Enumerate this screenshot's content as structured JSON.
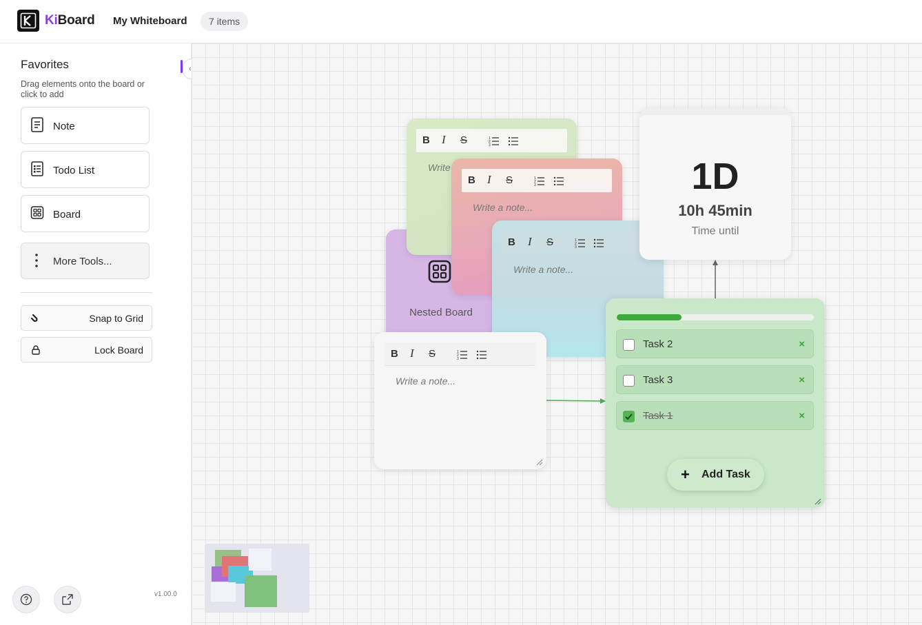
{
  "header": {
    "logo_prefix": "Ki",
    "logo_suffix": "Board",
    "board_title": "My Whiteboard",
    "items_count": "7 items"
  },
  "sidebar": {
    "title": "Favorites",
    "subtitle": "Drag elements onto the board or click to add",
    "tools": [
      {
        "label": "Note",
        "icon": "note-icon"
      },
      {
        "label": "Todo List",
        "icon": "todo-list-icon"
      },
      {
        "label": "Board",
        "icon": "board-icon"
      }
    ],
    "more_tools": "More Tools...",
    "snap_to_grid": "Snap to Grid",
    "lock_board": "Lock Board",
    "collapse_glyph": "‹",
    "version": "v1.00.0"
  },
  "canvas": {
    "note_placeholder": "Write a note...",
    "note_placeholder_truncated": "Write",
    "nested_board_label": "Nested Board",
    "timer": {
      "days": "1D",
      "hours_minutes": "10h 45min",
      "caption": "Time until"
    },
    "todo": {
      "progress_percent": 33,
      "tasks": [
        {
          "label": "Task 2",
          "done": false
        },
        {
          "label": "Task 3",
          "done": false
        },
        {
          "label": "Task 1",
          "done": true
        }
      ],
      "delete_glyph": "×",
      "add_label": "Add Task",
      "add_glyph": "+"
    },
    "toolbar": {
      "bold": "B",
      "italic": "I",
      "strike": "S"
    }
  },
  "colors": {
    "brand_accent": "#8b3fd9",
    "note_green": "#d4e6c4",
    "note_pink": "#eab0b8",
    "note_cyan": "#b8e6ee",
    "nested_board_purple": "#d7b6e6",
    "todo_green": "#c9e8c9",
    "progress": "#3eaa3e"
  }
}
